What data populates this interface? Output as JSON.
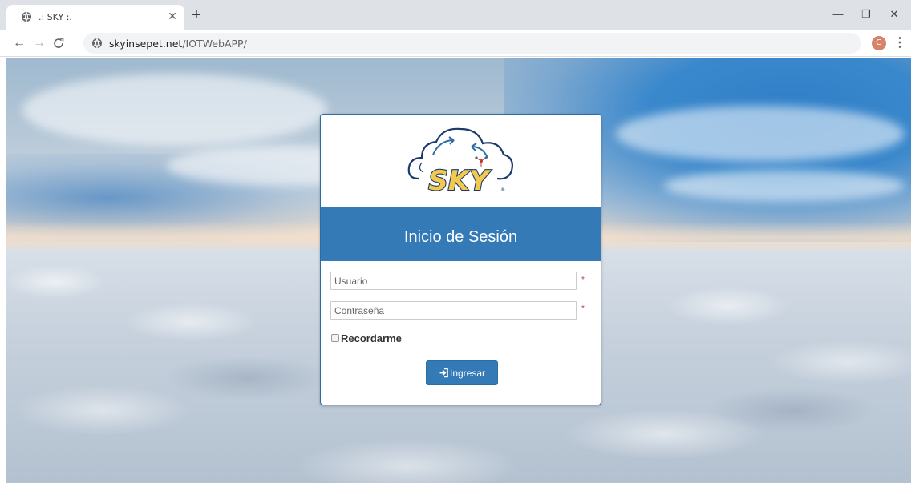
{
  "browser": {
    "tab": {
      "title": ".: SKY :.",
      "close_icon": "close-icon"
    },
    "new_tab_label": "+",
    "window_controls": {
      "minimize": "—",
      "restore": "❐",
      "close": "✕"
    },
    "nav": {
      "back": "←",
      "forward": "→",
      "reload": "C"
    },
    "address_bar": {
      "domain": "skyinsepet.net",
      "path": "/IOTWebAPP/"
    },
    "profile_avatar_initial": "G",
    "menu_icon": "⋮"
  },
  "login": {
    "logo_text": "SKY",
    "heading": "Inicio de Sesión",
    "username": {
      "placeholder": "Usuario",
      "required_marker": "*"
    },
    "password": {
      "placeholder": "Contraseña",
      "required_marker": "*"
    },
    "remember_label": "Recordarme",
    "submit_label": "Ingresar"
  },
  "colors": {
    "primary": "#337ab7",
    "logo_yellow": "#f2c94c",
    "logo_navy": "#1b3a6b"
  }
}
